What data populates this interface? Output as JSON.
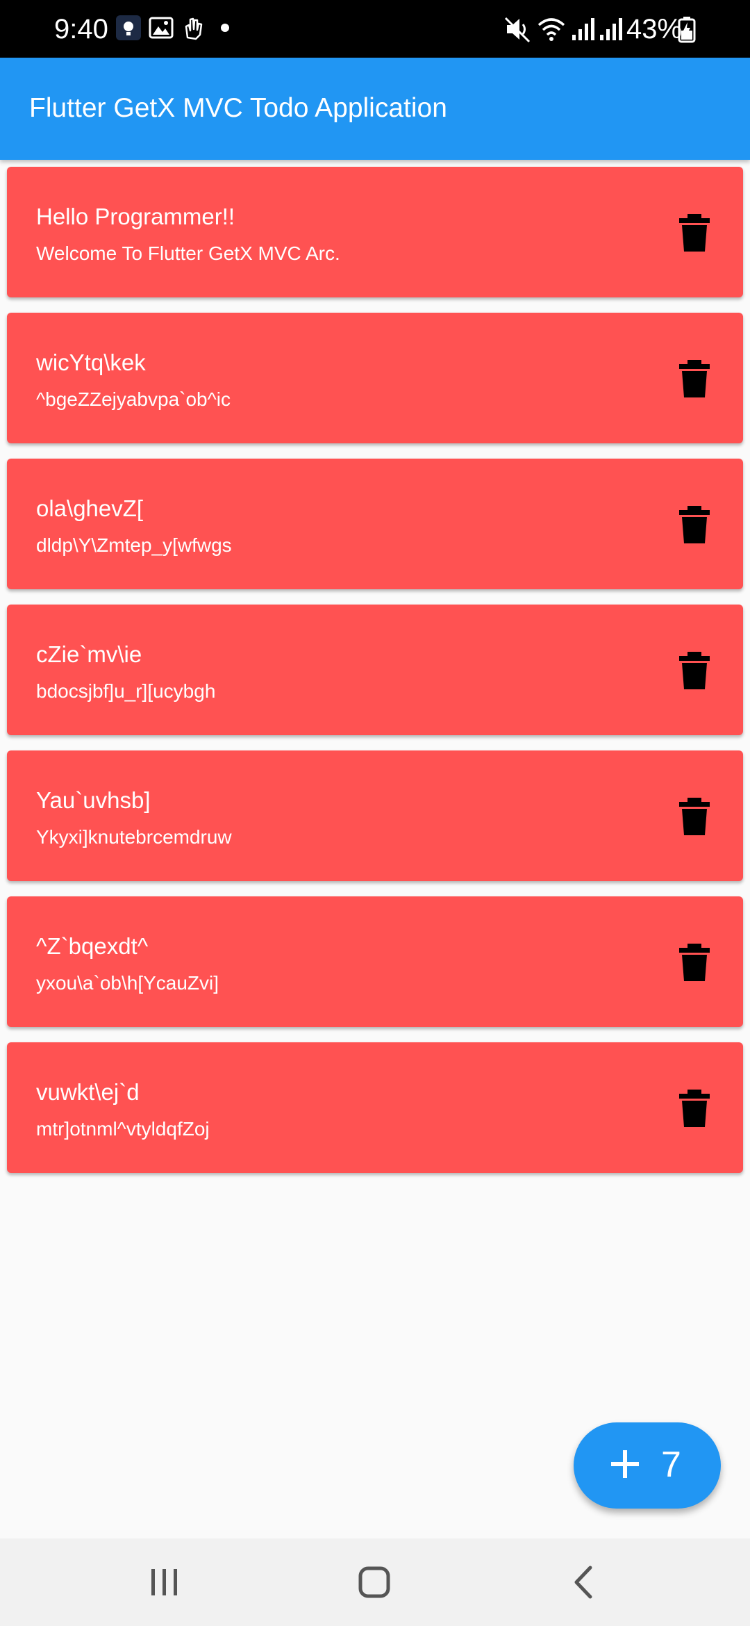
{
  "status_bar": {
    "time": "9:40",
    "left_icons": [
      "brightness-icon",
      "image-icon",
      "gesture-icon",
      "dot"
    ],
    "right_icons": [
      "mute-icon",
      "wifi-icon",
      "signal-icon",
      "signal-icon"
    ],
    "battery": "43%"
  },
  "app_bar": {
    "title": "Flutter GetX MVC Todo Application",
    "color": "#2196f3"
  },
  "todos": [
    {
      "title": "Hello Programmer!!",
      "subtitle": "Welcome To Flutter GetX MVC Arc."
    },
    {
      "title": "wicYtq\\kek",
      "subtitle": "^bgeZZejyabvpa`ob^ic"
    },
    {
      "title": "ola\\ghevZ[",
      "subtitle": "dldp\\Y\\Zmtep_y[wfwgs"
    },
    {
      "title": "cZie`mv\\ie",
      "subtitle": "bdocsjbf]u_r][ucybgh"
    },
    {
      "title": "Yau`uvhsb]",
      "subtitle": "Ykyxi]knutebrcemdruw"
    },
    {
      "title": "^Z`bqexdt^",
      "subtitle": "yxou\\a`ob\\h[YcauZvi]"
    },
    {
      "title": "vuwkt\\ej`d",
      "subtitle": "mtr]otnml^vtyldqfZoj"
    }
  ],
  "card_color": "#ff5252",
  "fab": {
    "icon": "plus-icon",
    "count": "7"
  },
  "nav_bar": {
    "buttons": [
      "recent-apps-icon",
      "home-icon",
      "back-icon"
    ]
  }
}
